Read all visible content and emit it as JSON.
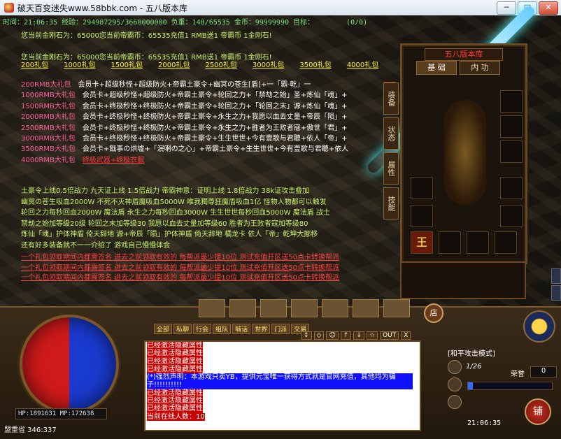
{
  "window": {
    "title": "破天百变迷失www.58bbk.com - 五八版本库",
    "buttons": [
      "─",
      "□",
      "✕"
    ]
  },
  "status": {
    "line": "时间：21:06:35 经验：294987295/3660000000 负重：148/65535 金币：99999990 目标：",
    "target_tail": "(0/0)"
  },
  "system_messages": [
    {
      "text": "您当前金刚石为：65000您当前帝霸币：65535充值1 RMB送1 帝霸币  1金刚石!"
    },
    {
      "text": "您当前金刚石为：65000您当前帝霸币：65535充值1 RMB送1 帝霸币  1金刚石!"
    }
  ],
  "packages": [
    "200礼包",
    "1000礼包",
    "1500礼包",
    "2000礼包",
    "2500礼包",
    "3000礼包",
    "3500礼包",
    "4000礼包"
  ],
  "big_packages": [
    {
      "key": "200RMB大礼包",
      "value": "会员卡+超级秒怪+超级防火+帝霸土豪令+幽冥の苍生[盾]+一「霸·乾」一"
    },
    {
      "key": "1000RMB大礼包",
      "value": "会员卡+超级秒怪+超级防火+帝霸土豪令+轮回之力+「禁劫之始」圣+炼仙「魂」+"
    },
    {
      "key": "1500RMB大礼包",
      "value": "会员卡+终极秒怪+终极防火+帝霸土豪令+轮回之力+「轮回之末」源+炼仙「魂」+"
    },
    {
      "key": "2000RMB大礼包",
      "value": "会员卡+终极秒怪+终极防火+帝霸土豪令+永生之力+我愿以血去丈量+帝辰「陨」+"
    },
    {
      "key": "2500RMB大礼包",
      "value": "会员卡+终极秒怪+终极防火+帝霸土豪令+永生之力+胜者为王败者寇+傲世「君」+"
    },
    {
      "key": "3000RMB大礼包",
      "value": "会员卡+终极秒怪+终极防火+帝霸土豪令+生生世世+今有壹歌与君聽+依人「帝」+"
    },
    {
      "key": "3500RMB大礼包",
      "value": "会员卡+戬事の烘墟+「泯喇の之心」+帝霸土豪令+生生世世+今有壹歌与君聽+依人"
    },
    {
      "key": "4000RMB大礼包",
      "value": "终极武器+终极衣服",
      "red": true
    }
  ],
  "info_lines": [
    "土豪令上线0.5倍战力   九天证上线 1.5倍战力    帝霸神意：证明上线 1.8倍战力 38k证攻击叠加",
    "幽冥の苍生吸血2000W   不死不灭神盾魔吸血5000W   唯我獨尊狂魔盾吸血1亿  怪物人物都可以触发",
    "轮回之力每秒回血2000W  魔法盾  永生之力每秒回血3000W  生生世世每秒回血5000W 魔法盾 战士",
    "禁劫之始加等级20级    轮回之末加等级30 我愿以血去丈量加等级60   胜者为王败者寇加等级80",
    "炼仙「魂」护体神盾 倚天辞地    源+帝辰「陨」护体神盾 倚天辞地  橘龙卡 依人「帝」乾坤大挪移",
    "还有好多装备就不一一介绍了  游戏自己慢慢体会"
  ],
  "notices": [
    "一个礼包领取期间内都需签名 进去之前领取有效的   每帮派最少提10位  测试充值开区送50点卡转换帮派",
    "一个礼包领取期间内都需签名 进去之前领取有效的   每帮派最少提10位  测试充值开区送50点卡转换帮派",
    "一个礼包领取期间内都需签名 进去之前领取有效的   每帮派最少提10位  测试充值开区送50点卡转换帮派"
  ],
  "equip": {
    "header": "五八版本库",
    "tabs": [
      "基 础",
      "内 功"
    ],
    "side_tabs": [
      "装备",
      "状态",
      "属性",
      "技能"
    ],
    "king_char": "王"
  },
  "hud": {
    "hp_mp": "HP:1891631 MP:172638",
    "map": "盟重省 346:337",
    "chat_tabs": [
      "全部",
      "私聊",
      "行会",
      "组队",
      "喊话",
      "世界",
      "门派",
      "交易"
    ],
    "tool_buttons": [
      "↕",
      "◇",
      "☺",
      "↑",
      "↓",
      "☆",
      "OUT",
      "X"
    ],
    "chat_lines": [
      {
        "text": "已经激活隐藏属性",
        "kind": "red"
      },
      {
        "text": "已经激活隐藏属性",
        "kind": "red"
      },
      {
        "text": "已经激活隐藏属性",
        "kind": "red"
      },
      {
        "text": "已经激活隐藏属性",
        "kind": "red"
      },
      {
        "text": "(*)强烈声明：本游戏只卖YB，提供元宝唯一获得方式就是官网充值，其他均为骗子!!!!!!!!!!",
        "kind": "blue"
      },
      {
        "text": "已经激活隐藏属性",
        "kind": "red"
      },
      {
        "text": "已经激活隐藏属性",
        "kind": "red"
      },
      {
        "text": "已经激活隐藏属性",
        "kind": "red"
      },
      {
        "text": "当前在线人数：10",
        "kind": "red"
      }
    ],
    "attack_mode": "[和平攻击模式]",
    "level": "1/26",
    "honor_label": "荣誉",
    "honor_value": "0",
    "exp_fraction": 0.06,
    "clock": "21:06:35",
    "shop": "铺",
    "shop_top": "店"
  }
}
